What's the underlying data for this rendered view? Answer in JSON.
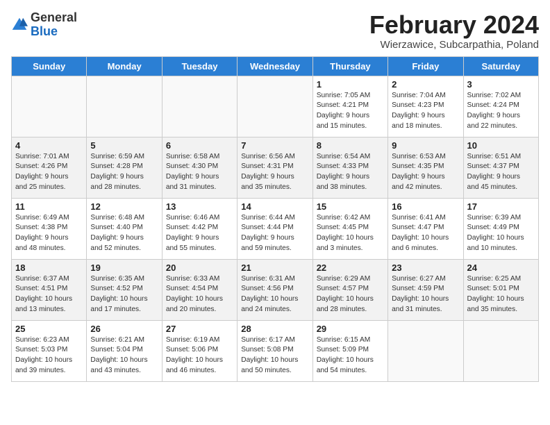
{
  "logo": {
    "general": "General",
    "blue": "Blue"
  },
  "header": {
    "title": "February 2024",
    "subtitle": "Wierzawice, Subcarpathia, Poland"
  },
  "weekdays": [
    "Sunday",
    "Monday",
    "Tuesday",
    "Wednesday",
    "Thursday",
    "Friday",
    "Saturday"
  ],
  "rows": [
    {
      "cells": [
        {
          "empty": true
        },
        {
          "empty": true
        },
        {
          "empty": true
        },
        {
          "empty": true
        },
        {
          "day": "1",
          "info": "Sunrise: 7:05 AM\nSunset: 4:21 PM\nDaylight: 9 hours\nand 15 minutes."
        },
        {
          "day": "2",
          "info": "Sunrise: 7:04 AM\nSunset: 4:23 PM\nDaylight: 9 hours\nand 18 minutes."
        },
        {
          "day": "3",
          "info": "Sunrise: 7:02 AM\nSunset: 4:24 PM\nDaylight: 9 hours\nand 22 minutes."
        }
      ]
    },
    {
      "cells": [
        {
          "day": "4",
          "info": "Sunrise: 7:01 AM\nSunset: 4:26 PM\nDaylight: 9 hours\nand 25 minutes."
        },
        {
          "day": "5",
          "info": "Sunrise: 6:59 AM\nSunset: 4:28 PM\nDaylight: 9 hours\nand 28 minutes."
        },
        {
          "day": "6",
          "info": "Sunrise: 6:58 AM\nSunset: 4:30 PM\nDaylight: 9 hours\nand 31 minutes."
        },
        {
          "day": "7",
          "info": "Sunrise: 6:56 AM\nSunset: 4:31 PM\nDaylight: 9 hours\nand 35 minutes."
        },
        {
          "day": "8",
          "info": "Sunrise: 6:54 AM\nSunset: 4:33 PM\nDaylight: 9 hours\nand 38 minutes."
        },
        {
          "day": "9",
          "info": "Sunrise: 6:53 AM\nSunset: 4:35 PM\nDaylight: 9 hours\nand 42 minutes."
        },
        {
          "day": "10",
          "info": "Sunrise: 6:51 AM\nSunset: 4:37 PM\nDaylight: 9 hours\nand 45 minutes."
        }
      ]
    },
    {
      "cells": [
        {
          "day": "11",
          "info": "Sunrise: 6:49 AM\nSunset: 4:38 PM\nDaylight: 9 hours\nand 48 minutes."
        },
        {
          "day": "12",
          "info": "Sunrise: 6:48 AM\nSunset: 4:40 PM\nDaylight: 9 hours\nand 52 minutes."
        },
        {
          "day": "13",
          "info": "Sunrise: 6:46 AM\nSunset: 4:42 PM\nDaylight: 9 hours\nand 55 minutes."
        },
        {
          "day": "14",
          "info": "Sunrise: 6:44 AM\nSunset: 4:44 PM\nDaylight: 9 hours\nand 59 minutes."
        },
        {
          "day": "15",
          "info": "Sunrise: 6:42 AM\nSunset: 4:45 PM\nDaylight: 10 hours\nand 3 minutes."
        },
        {
          "day": "16",
          "info": "Sunrise: 6:41 AM\nSunset: 4:47 PM\nDaylight: 10 hours\nand 6 minutes."
        },
        {
          "day": "17",
          "info": "Sunrise: 6:39 AM\nSunset: 4:49 PM\nDaylight: 10 hours\nand 10 minutes."
        }
      ]
    },
    {
      "cells": [
        {
          "day": "18",
          "info": "Sunrise: 6:37 AM\nSunset: 4:51 PM\nDaylight: 10 hours\nand 13 minutes."
        },
        {
          "day": "19",
          "info": "Sunrise: 6:35 AM\nSunset: 4:52 PM\nDaylight: 10 hours\nand 17 minutes."
        },
        {
          "day": "20",
          "info": "Sunrise: 6:33 AM\nSunset: 4:54 PM\nDaylight: 10 hours\nand 20 minutes."
        },
        {
          "day": "21",
          "info": "Sunrise: 6:31 AM\nSunset: 4:56 PM\nDaylight: 10 hours\nand 24 minutes."
        },
        {
          "day": "22",
          "info": "Sunrise: 6:29 AM\nSunset: 4:57 PM\nDaylight: 10 hours\nand 28 minutes."
        },
        {
          "day": "23",
          "info": "Sunrise: 6:27 AM\nSunset: 4:59 PM\nDaylight: 10 hours\nand 31 minutes."
        },
        {
          "day": "24",
          "info": "Sunrise: 6:25 AM\nSunset: 5:01 PM\nDaylight: 10 hours\nand 35 minutes."
        }
      ]
    },
    {
      "cells": [
        {
          "day": "25",
          "info": "Sunrise: 6:23 AM\nSunset: 5:03 PM\nDaylight: 10 hours\nand 39 minutes."
        },
        {
          "day": "26",
          "info": "Sunrise: 6:21 AM\nSunset: 5:04 PM\nDaylight: 10 hours\nand 43 minutes."
        },
        {
          "day": "27",
          "info": "Sunrise: 6:19 AM\nSunset: 5:06 PM\nDaylight: 10 hours\nand 46 minutes."
        },
        {
          "day": "28",
          "info": "Sunrise: 6:17 AM\nSunset: 5:08 PM\nDaylight: 10 hours\nand 50 minutes."
        },
        {
          "day": "29",
          "info": "Sunrise: 6:15 AM\nSunset: 5:09 PM\nDaylight: 10 hours\nand 54 minutes."
        },
        {
          "empty": true
        },
        {
          "empty": true
        }
      ]
    }
  ]
}
